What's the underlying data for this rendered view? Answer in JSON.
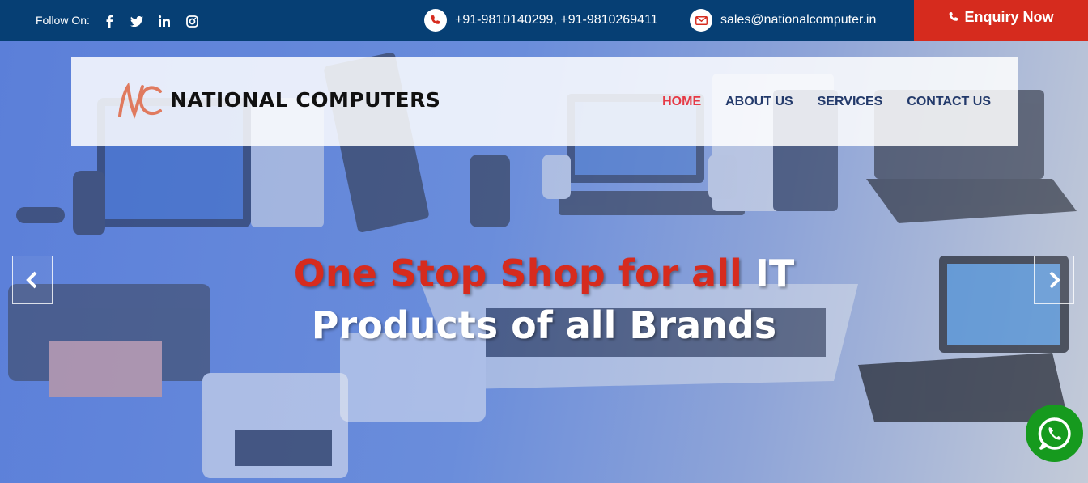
{
  "topbar": {
    "follow_label": "Follow On:",
    "social_icons": [
      "facebook-icon",
      "twitter-icon",
      "linkedin-icon",
      "instagram-icon"
    ],
    "phone_text": "+91-9810140299, +91-9810269411",
    "email_text": "sales@nationalcomputer.in",
    "enquiry_label": "Enquiry Now",
    "bar_color": "#063f74",
    "enquiry_color": "#d62b1e"
  },
  "nav": {
    "brand": "NATIONAL COMPUTERS",
    "items": [
      {
        "label": "HOME",
        "active": true
      },
      {
        "label": "ABOUT US",
        "active": false
      },
      {
        "label": "SERVICES",
        "active": false
      },
      {
        "label": "CONTACT US",
        "active": false
      }
    ]
  },
  "hero": {
    "headline_red": "One Stop Shop for all",
    "headline_white_1": " IT",
    "headline_white_2": "Products of all Brands",
    "accent_red": "#d62b1e"
  },
  "controls": {
    "prev_icon": "chevron-left-icon",
    "next_icon": "chevron-right-icon",
    "whatsapp_icon": "whatsapp-icon"
  }
}
